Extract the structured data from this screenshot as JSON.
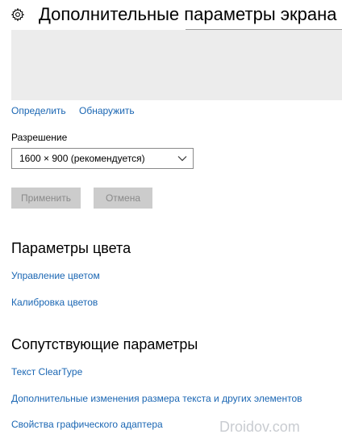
{
  "header": {
    "title": "Дополнительные параметры экрана"
  },
  "display": {
    "identify_label": "Определить",
    "detect_label": "Обнаружить"
  },
  "resolution": {
    "label": "Разрешение",
    "selected_value": "1600 × 900 (рекомендуется)"
  },
  "actions": {
    "apply_label": "Применить",
    "cancel_label": "Отмена"
  },
  "color_settings": {
    "heading": "Параметры цвета",
    "links": [
      "Управление цветом",
      "Калибровка цветов"
    ]
  },
  "related_settings": {
    "heading": "Сопутствующие параметры",
    "links": [
      "Текст ClearType",
      "Дополнительные изменения размера текста и других элементов",
      "Свойства графического адаптера"
    ]
  },
  "watermark": "Droidov.com",
  "colors": {
    "link": "#1a66b3",
    "preview_background": "#ececec",
    "disabled_button": "#cccccc",
    "disabled_text": "#8a8a8a"
  },
  "icons": {
    "settings": "gear-icon",
    "dropdown": "chevron-down-icon"
  }
}
